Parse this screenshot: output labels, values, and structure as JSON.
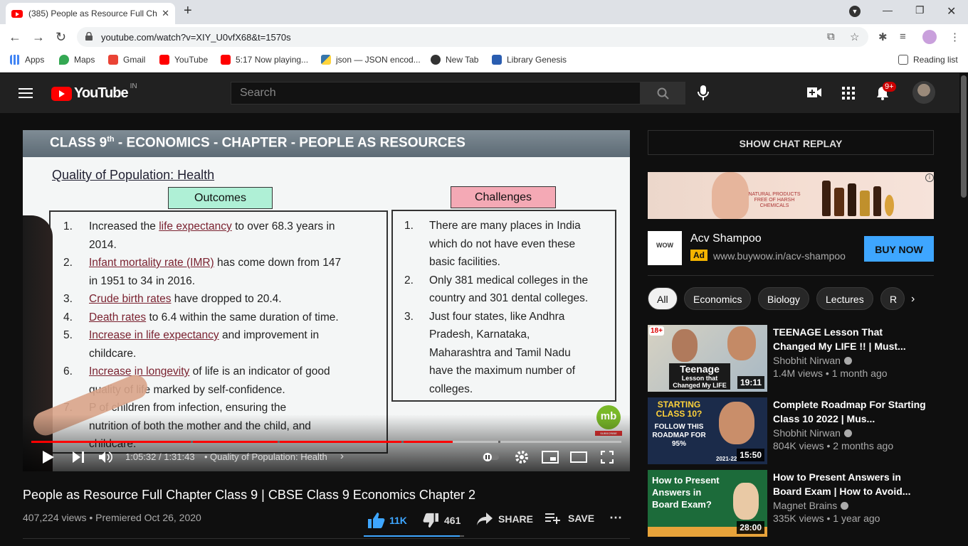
{
  "browser": {
    "tab_title": "(385) People as Resource Full Cha",
    "url": "youtube.com/watch?v=XIY_U0vfX68&t=1570s",
    "bookmarks": [
      {
        "label": "Apps",
        "icon": "apps-grid-icon"
      },
      {
        "label": "Maps",
        "icon": "maps-pin-icon"
      },
      {
        "label": "Gmail",
        "icon": "gmail-icon"
      },
      {
        "label": "YouTube",
        "icon": "youtube-icon"
      },
      {
        "label": "5:17 Now playing...",
        "icon": "youtube-icon"
      },
      {
        "label": "json — JSON encod...",
        "icon": "python-icon"
      },
      {
        "label": "New Tab",
        "icon": "globe-icon"
      },
      {
        "label": "Library Genesis",
        "icon": "library-icon"
      }
    ],
    "reading_list": "Reading list"
  },
  "yt_header": {
    "logo_text": "YouTube",
    "country": "IN",
    "search_placeholder": "Search",
    "notif_badge": "9+"
  },
  "player": {
    "slide_title_a": "CLASS 9",
    "slide_title_sup": "th",
    "slide_title_b": " - ECONOMICS - CHAPTER - PEOPLE AS RESOURCES",
    "slide_heading": "Quality of Population: Health",
    "outcomes_label": "Outcomes",
    "challenges_label": "Challenges",
    "outcomes": [
      {
        "n": "1.",
        "pre": "Increased the ",
        "u": "life expectancy",
        "post": " to over 68.3 years in"
      },
      {
        "n": "",
        "pre": "2014.",
        "u": "",
        "post": ""
      },
      {
        "n": "2.",
        "pre": "",
        "u": "Infant mortality rate (IMR)",
        "post": " has come down from 147"
      },
      {
        "n": "",
        "pre": "in 1951 to 34 in 2016.",
        "u": "",
        "post": ""
      },
      {
        "n": "3.",
        "pre": "",
        "u": "Crude birth rates",
        "post": " have dropped to 20.4."
      },
      {
        "n": "4.",
        "pre": "",
        "u": "Death rates",
        "post": " to 6.4 within the same duration of time."
      },
      {
        "n": "5.",
        "pre": "",
        "u": "Increase in life expectancy",
        "post": " and improvement in"
      },
      {
        "n": "",
        "pre": "childcare.",
        "u": "",
        "post": ""
      },
      {
        "n": "6.",
        "pre": "",
        "u": "Increase in longevity",
        "post": " of life is an indicator of good"
      },
      {
        "n": "",
        "pre": "quality of life marked by self-confidence.",
        "u": "",
        "post": ""
      },
      {
        "n": "7.",
        "pre": "P          of children from infection, ensuring the",
        "u": "",
        "post": ""
      },
      {
        "n": "",
        "pre": "nutrition of both the mother and the child, and",
        "u": "",
        "post": ""
      },
      {
        "n": "",
        "pre": "childcare.",
        "u": "",
        "post": ""
      }
    ],
    "challenges": [
      {
        "n": "1.",
        "text": "There are many places in India"
      },
      {
        "n": "",
        "text": "which do not have even these"
      },
      {
        "n": "",
        "text": "basic facilities."
      },
      {
        "n": "2.",
        "text": "Only 381 medical colleges in the"
      },
      {
        "n": "",
        "text": "country and 301 dental colleges."
      },
      {
        "n": "3.",
        "text": "Just four states, like Andhra"
      },
      {
        "n": "",
        "text": "Pradesh, Karnataka,"
      },
      {
        "n": "",
        "text": "Maharashtra and Tamil Nadu"
      },
      {
        "n": "",
        "text": "have the maximum number of"
      },
      {
        "n": "",
        "text": "colleges."
      }
    ],
    "channel_logo": "mb",
    "channel_logo_sub": "SUBSCRIBE",
    "time": "1:05:32 / 1:31:43",
    "chapter": "Quality of Population: Health",
    "progress": 0.7145
  },
  "video": {
    "title": "People as Resource Full Chapter Class 9 | CBSE Class 9 Economics Chapter 2",
    "views_date": "407,224 views • Premiered Oct 26, 2020",
    "likes": "11K",
    "dislikes": "461",
    "share": "SHARE",
    "save": "SAVE",
    "like_ratio": 0.96
  },
  "sidebar": {
    "chat_replay": "SHOW CHAT REPLAY",
    "ad": {
      "banner_text": "NATURAL PRODUCTS FREE OF HARSH CHEMICALS",
      "logo_text": "WOW",
      "title": "Acv Shampoo",
      "ad_label": "Ad",
      "url": "www.buywow.in/acv-shampoo",
      "cta": "BUY NOW"
    },
    "chips": [
      "All",
      "Economics",
      "Biology",
      "Lectures",
      "R"
    ],
    "videos": [
      {
        "title": "TEENAGE Lesson That Changed My LIFE !! | Must...",
        "channel": "Shobhit Nirwan",
        "meta": "1.4M views • 1 month ago",
        "duration": "19:11",
        "thumb_big": "Teenage",
        "thumb_small": "Lesson that Changed My LIFE",
        "thumb_tag": "18+"
      },
      {
        "title": "Complete Roadmap For Starting Class 10 2022 | Mus...",
        "channel": "Shobhit Nirwan",
        "meta": "804K views • 2 months ago",
        "duration": "15:50",
        "thumb_big": "STARTING CLASS 10?",
        "thumb_small": "FOLLOW THIS ROADMAP FOR 95%",
        "thumb_tag": "2021-22"
      },
      {
        "title": "How to Present Answers in Board Exam | How to Avoid...",
        "channel": "Magnet Brains",
        "meta": "335K views • 1 year ago",
        "duration": "28:00",
        "thumb_big": "How to Present Answers in Board Exam?",
        "thumb_small": "",
        "thumb_tag": ""
      }
    ]
  }
}
